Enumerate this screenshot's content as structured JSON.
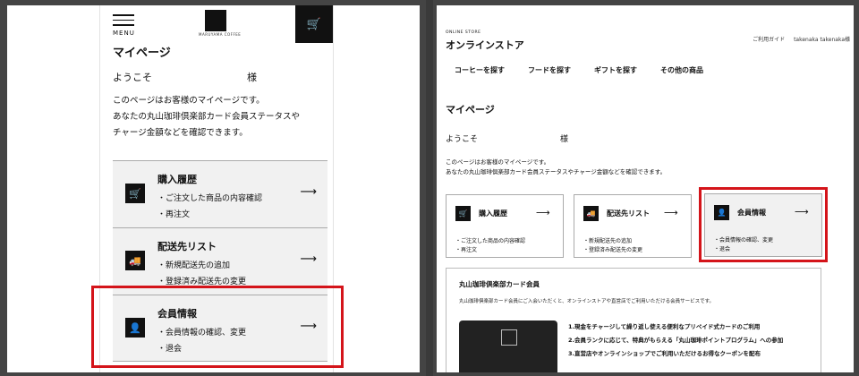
{
  "mobile": {
    "menu_label": "MENU",
    "logo_text": "MARUYAMA COFFEE",
    "page_title": "マイページ",
    "welcome": "ようこそ",
    "honorific": "様",
    "desc1": "このページはお客様のマイページです。",
    "desc2": "あなたの丸山珈琲倶楽部カード会員ステータスや",
    "desc3": "チャージ金額などを確認できます。",
    "cards": [
      {
        "icon": "cart-icon",
        "title": "購入履歴",
        "lines": [
          "・ご注文した商品の内容確認",
          "・再注文"
        ],
        "arrow": "⟶"
      },
      {
        "icon": "truck-icon",
        "title": "配送先リスト",
        "lines": [
          "・新規配送先の追加",
          "・登録済み配送先の変更"
        ],
        "arrow": "⟶"
      },
      {
        "icon": "user-icon",
        "title": "会員情報",
        "lines": [
          "・会員情報の確認、変更",
          "・退会"
        ],
        "arrow": "⟶"
      }
    ]
  },
  "desktop": {
    "store_label": "ONLINE STORE",
    "store_title": "オンラインストア",
    "util_guide": "ご利用ガイド",
    "util_user": "takenaka takenaka様",
    "nav": [
      "コーヒーを探す",
      "フードを探す",
      "ギフトを探す",
      "その他の商品"
    ],
    "page_title": "マイページ",
    "welcome": "ようこそ",
    "honorific": "様",
    "desc1": "このページはお客様のマイページです。",
    "desc2": "あなたの丸山珈琲倶楽部カード会員ステータスやチャージ金額などを確認できます。",
    "cards": [
      {
        "title": "購入履歴",
        "lines": [
          "・ご注文した商品の内容確認",
          "・再注文"
        ],
        "arrow": "⟶"
      },
      {
        "title": "配送先リスト",
        "lines": [
          "・新規配送先の追加",
          "・登録済み配送先の変更"
        ],
        "arrow": "⟶"
      },
      {
        "title": "会員情報",
        "lines": [
          "・会員情報の確認、変更",
          "・退会"
        ],
        "arrow": "⟶"
      }
    ],
    "club_title": "丸山珈琲倶楽部カード会員",
    "club_desc": "丸山珈琲倶楽部カード会員にご入会いただくと、オンラインストアや直営店でご利用いただける会員サービスです。",
    "benefits": [
      "1.現金をチャージして繰り返し使える便利なプリペイド式カードのご利用",
      "2.会員ランクに応じて、特典がもらえる「丸山珈琲ポイントプログラム」への参加",
      "3.直営店やオンラインショップでご利用いただけるお得なクーポンを配布"
    ]
  },
  "colors": {
    "highlight": "#d4141a",
    "card_bg": "#f1f1f1",
    "icon_bg": "#111111"
  }
}
